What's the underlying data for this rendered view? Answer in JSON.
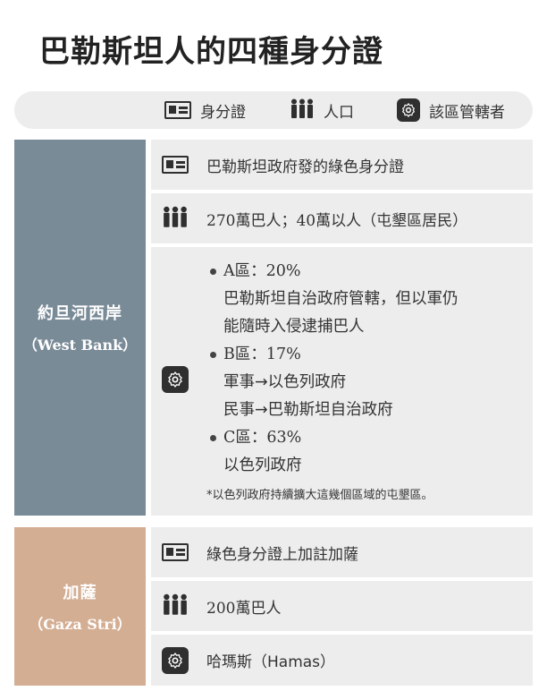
{
  "title": "巴勒斯坦人的四種身分證",
  "legend": [
    {
      "icon": "id-card-icon",
      "label": "身分證"
    },
    {
      "icon": "people-icon",
      "label": "人口"
    },
    {
      "icon": "gear-icon",
      "label": "該區管轄者"
    }
  ],
  "west_bank": {
    "name": "約旦河西岸",
    "subtitle": "（West Bank）",
    "id_card": "巴勒斯坦政府發的綠色身分證",
    "population": "270萬巴人；40萬以人（屯墾區居民）",
    "zones": [
      {
        "head": "A區：20%",
        "lines": [
          "巴勒斯坦自治政府管轄，但以軍仍",
          "能隨時入侵逮捕巴人"
        ]
      },
      {
        "head": "B區：17%",
        "lines": [
          "軍事→以色列政府",
          "民事→巴勒斯坦自治政府"
        ]
      },
      {
        "head": "C區：63%",
        "lines": [
          "以色列政府"
        ]
      }
    ],
    "note": "*以色列政府持續擴大這幾個區域的屯墾區。"
  },
  "gaza": {
    "name": "加薩",
    "subtitle": "（Gaza Stri）",
    "id_card": "綠色身分證上加註加薩",
    "population": "200萬巴人",
    "jurisdiction": "哈瑪斯（Hamas）"
  },
  "colors": {
    "west_bank": "#7a8b98",
    "gaza": "#d4ae93",
    "row_bg": "#ededed",
    "icon": "#2f2f2f"
  }
}
